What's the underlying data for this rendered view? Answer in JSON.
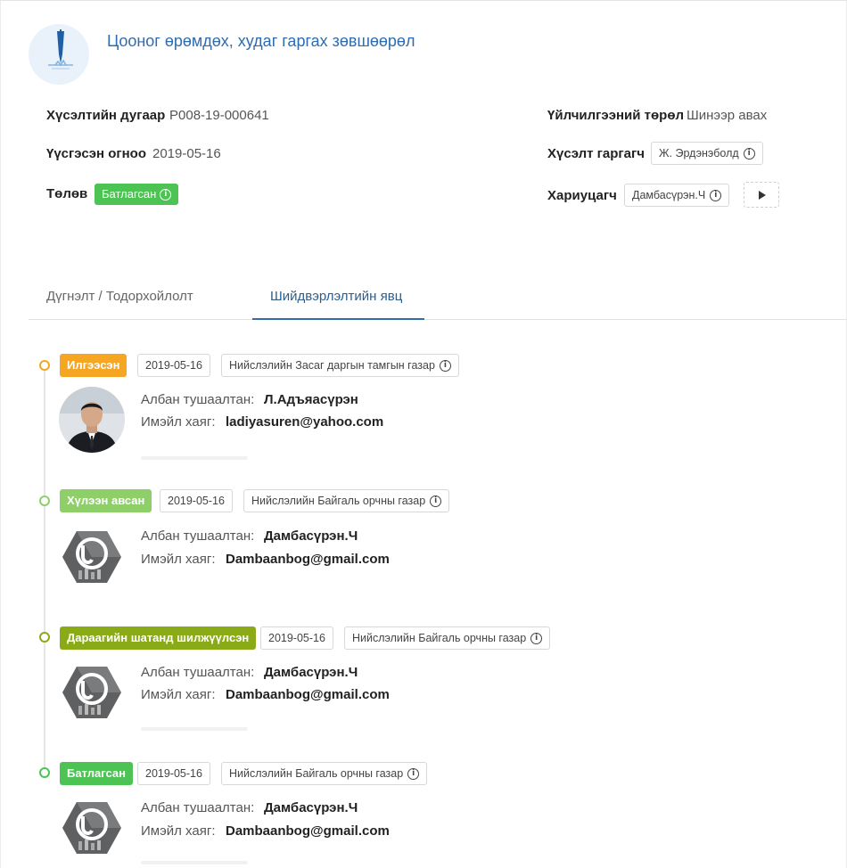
{
  "header": {
    "title": "Цооног өрөмдөх, худаг гаргах зөвшөөрөл",
    "logo_icon": "drill-icon"
  },
  "info": {
    "request_number_label": "Хүсэлтийн дугаар",
    "request_number_value": "P008-19-000641",
    "created_date_label": "Үүсгэсэн огноо",
    "created_date_value": "2019-05-16",
    "status_label": "Төлөв",
    "status_badge": "Батлагсан",
    "service_type_label": "Үйлчилгээний төрөл",
    "service_type_value": "Шинээр авах",
    "requester_label": "Хүсэлт гаргагч",
    "requester_value": "Ж. Эрдэнэболд",
    "responsible_label": "Хариуцагч",
    "responsible_value": "Дамбасүрэн.Ч"
  },
  "tabs": [
    {
      "label": "Дүгнэлт / Тодорхойлолт"
    },
    {
      "label": "Шийдвэрлэлтийн явц"
    }
  ],
  "labels": {
    "official": "Албан тушаалтан:",
    "email": "Имэйл хаяг:"
  },
  "timeline": [
    {
      "status": "Илгээсэн",
      "date": "2019-05-16",
      "org": "Нийслэлийн Засаг даргын тамгын газар",
      "official": "Л.Адъяасүрэн",
      "email": "ladiyasuren@yahoo.com",
      "avatar": "person-photo",
      "color": "#f5a623"
    },
    {
      "status": "Хүлээн авсан",
      "date": "2019-05-16",
      "org": "Нийслэлийн Байгаль орчны газар",
      "official": "Дамбасүрэн.Ч",
      "email": "Dambaanbog@gmail.com",
      "avatar": "uberp-logo",
      "color": "#8fcf6a"
    },
    {
      "status": "Дараагийн шатанд шилжүүлсэн",
      "date": "2019-05-16",
      "org": "Нийслэлийн Байгаль орчны газар",
      "official": "Дамбасүрэн.Ч",
      "email": "Dambaanbog@gmail.com",
      "avatar": "uberp-logo",
      "color": "#8aaa18"
    },
    {
      "status": "Батлагсан",
      "date": "2019-05-16",
      "org": "Нийслэлийн Байгаль орчны газар",
      "official": "Дамбасүрэн.Ч",
      "email": "Dambaanbog@gmail.com",
      "avatar": "uberp-logo",
      "color": "#4cc353"
    }
  ],
  "colors": {
    "accent": "#2f6cb0",
    "approved": "#4cc353",
    "sent": "#f5a623",
    "received": "#8fcf6a",
    "forwarded": "#8aaa18"
  }
}
